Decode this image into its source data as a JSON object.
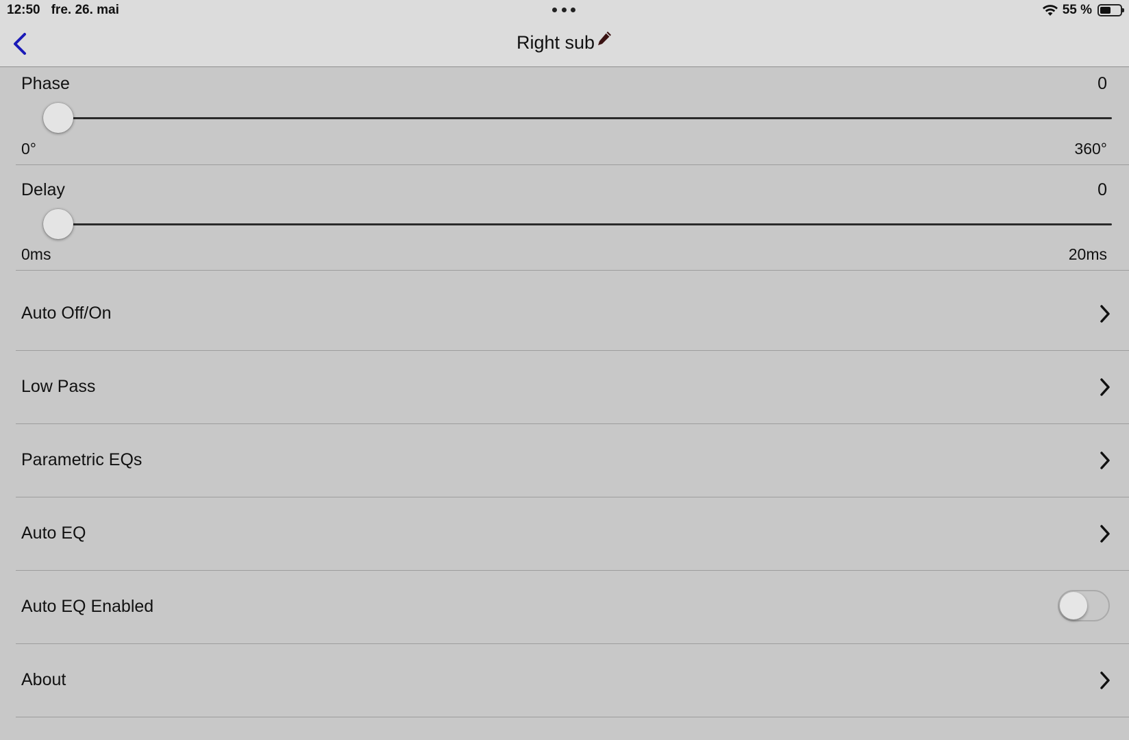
{
  "status_bar": {
    "time": "12:50",
    "date": "fre. 26. mai",
    "battery_percent": "55 %",
    "battery_level": 0.55
  },
  "nav": {
    "title": "Right sub"
  },
  "phase": {
    "label": "Phase",
    "value": "0",
    "min_label": "0°",
    "max_label": "360°",
    "min": 0,
    "max": 360,
    "current": 0
  },
  "delay": {
    "label": "Delay",
    "value": "0",
    "min_label": "0ms",
    "max_label": "20ms",
    "min": 0,
    "max": 20,
    "current": 0
  },
  "menu": {
    "items": [
      {
        "label": "Auto Off/On"
      },
      {
        "label": "Low Pass"
      },
      {
        "label": "Parametric EQs"
      },
      {
        "label": "Auto EQ"
      },
      {
        "label": "Auto EQ Enabled",
        "toggle": false
      },
      {
        "label": "About"
      }
    ]
  },
  "colors": {
    "background": "#c8c8c8",
    "bar_background": "#dcdcdc",
    "back_accent": "#1a1ab8",
    "pencil": "#3a1212"
  },
  "icons": {
    "back": "chevron-left-icon",
    "edit": "pencil-icon",
    "wifi": "wifi-icon",
    "battery": "battery-icon",
    "disclosure": "chevron-right-icon"
  }
}
